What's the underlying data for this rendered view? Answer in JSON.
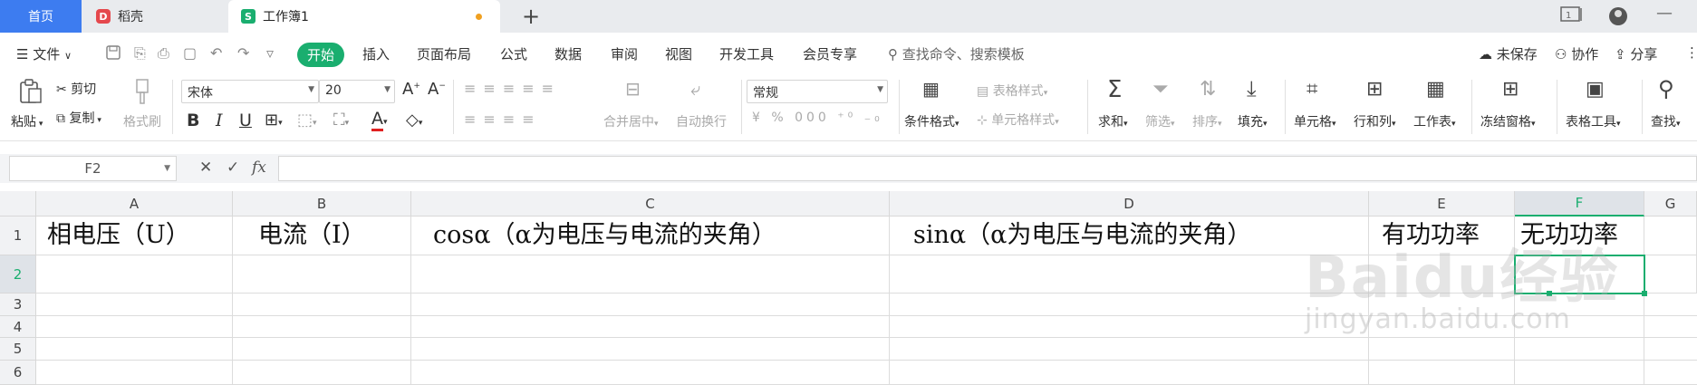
{
  "tabs": {
    "home": "首页",
    "docer": "稻壳",
    "doc": "工作簿1",
    "docer_logo": "D",
    "doc_logo": "S"
  },
  "menu": {
    "file": "文件",
    "active": "开始",
    "items": [
      "插入",
      "页面布局",
      "公式",
      "数据",
      "审阅",
      "视图",
      "开发工具",
      "会员专享"
    ],
    "search": "查找命令、搜索模板",
    "unsaved": "未保存",
    "collab": "协作",
    "share": "分享"
  },
  "ribbon": {
    "paste": "粘贴",
    "cut": "剪切",
    "copy": "复制",
    "format_painter": "格式刷",
    "font_name": "宋体",
    "font_size": "20",
    "bold": "B",
    "italic": "I",
    "underline": "U",
    "merge_center": "合并居中",
    "wrap_text": "自动换行",
    "number_format": "常规",
    "conditional_format": "条件格式",
    "table_style": "表格样式",
    "cell_style": "单元格样式",
    "sum": "求和",
    "filter": "筛选",
    "sort": "排序",
    "fill": "填充",
    "cell": "单元格",
    "row_col": "行和列",
    "worksheet": "工作表",
    "freeze": "冻结窗格",
    "table_tools": "表格工具",
    "find": "查找"
  },
  "formula_bar": {
    "name_box": "F2",
    "fx": "fx",
    "value": ""
  },
  "grid": {
    "columns": [
      "A",
      "B",
      "C",
      "D",
      "E",
      "F",
      "G"
    ],
    "rows": [
      "1",
      "2",
      "3",
      "4",
      "5",
      "6"
    ],
    "row1": [
      "相电压（U）",
      "电流（I）",
      "cosα（α为电压与电流的夹角）",
      "sinα（α为电压与电流的夹角）",
      "有功功率",
      "无功功率"
    ],
    "selected_cell": "F2"
  },
  "watermark": {
    "brand": "Baidu经验",
    "url": "jingyan.baidu.com"
  },
  "colors": {
    "accent": "#1aae6f",
    "home_tab": "#3d7cf0"
  }
}
